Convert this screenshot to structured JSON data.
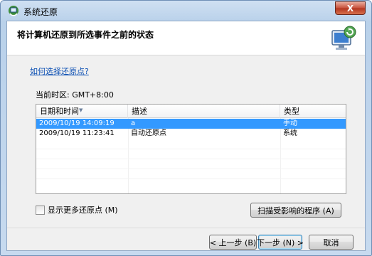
{
  "window": {
    "title": "系统还原",
    "close_label": "X",
    "icon": "system-restore-icon"
  },
  "header": {
    "title": "将计算机还原到所选事件之前的状态",
    "icon": "restore-monitor-icon"
  },
  "help_link": "如何选择还原点?",
  "timezone_label": "当前时区: GMT+8:00",
  "table": {
    "columns": [
      "日期和时间",
      "描述",
      "类型"
    ],
    "rows": [
      {
        "date": "2009/10/19 14:09:19",
        "desc": "a",
        "type": "手动",
        "selected": true
      },
      {
        "date": "2009/10/19 11:23:41",
        "desc": "自动还原点",
        "type": "系统",
        "selected": false
      }
    ]
  },
  "checkbox": {
    "label": "显示更多还原点 (M)",
    "checked": false
  },
  "buttons": {
    "scan": "扫描受影响的程序 (A)",
    "back": "< 上一步 (B)",
    "next": "下一步 (N) >",
    "cancel": "取消"
  },
  "colors": {
    "selection": "#3399ff",
    "link": "#0b4fb3",
    "close_button": "#c7503a"
  }
}
